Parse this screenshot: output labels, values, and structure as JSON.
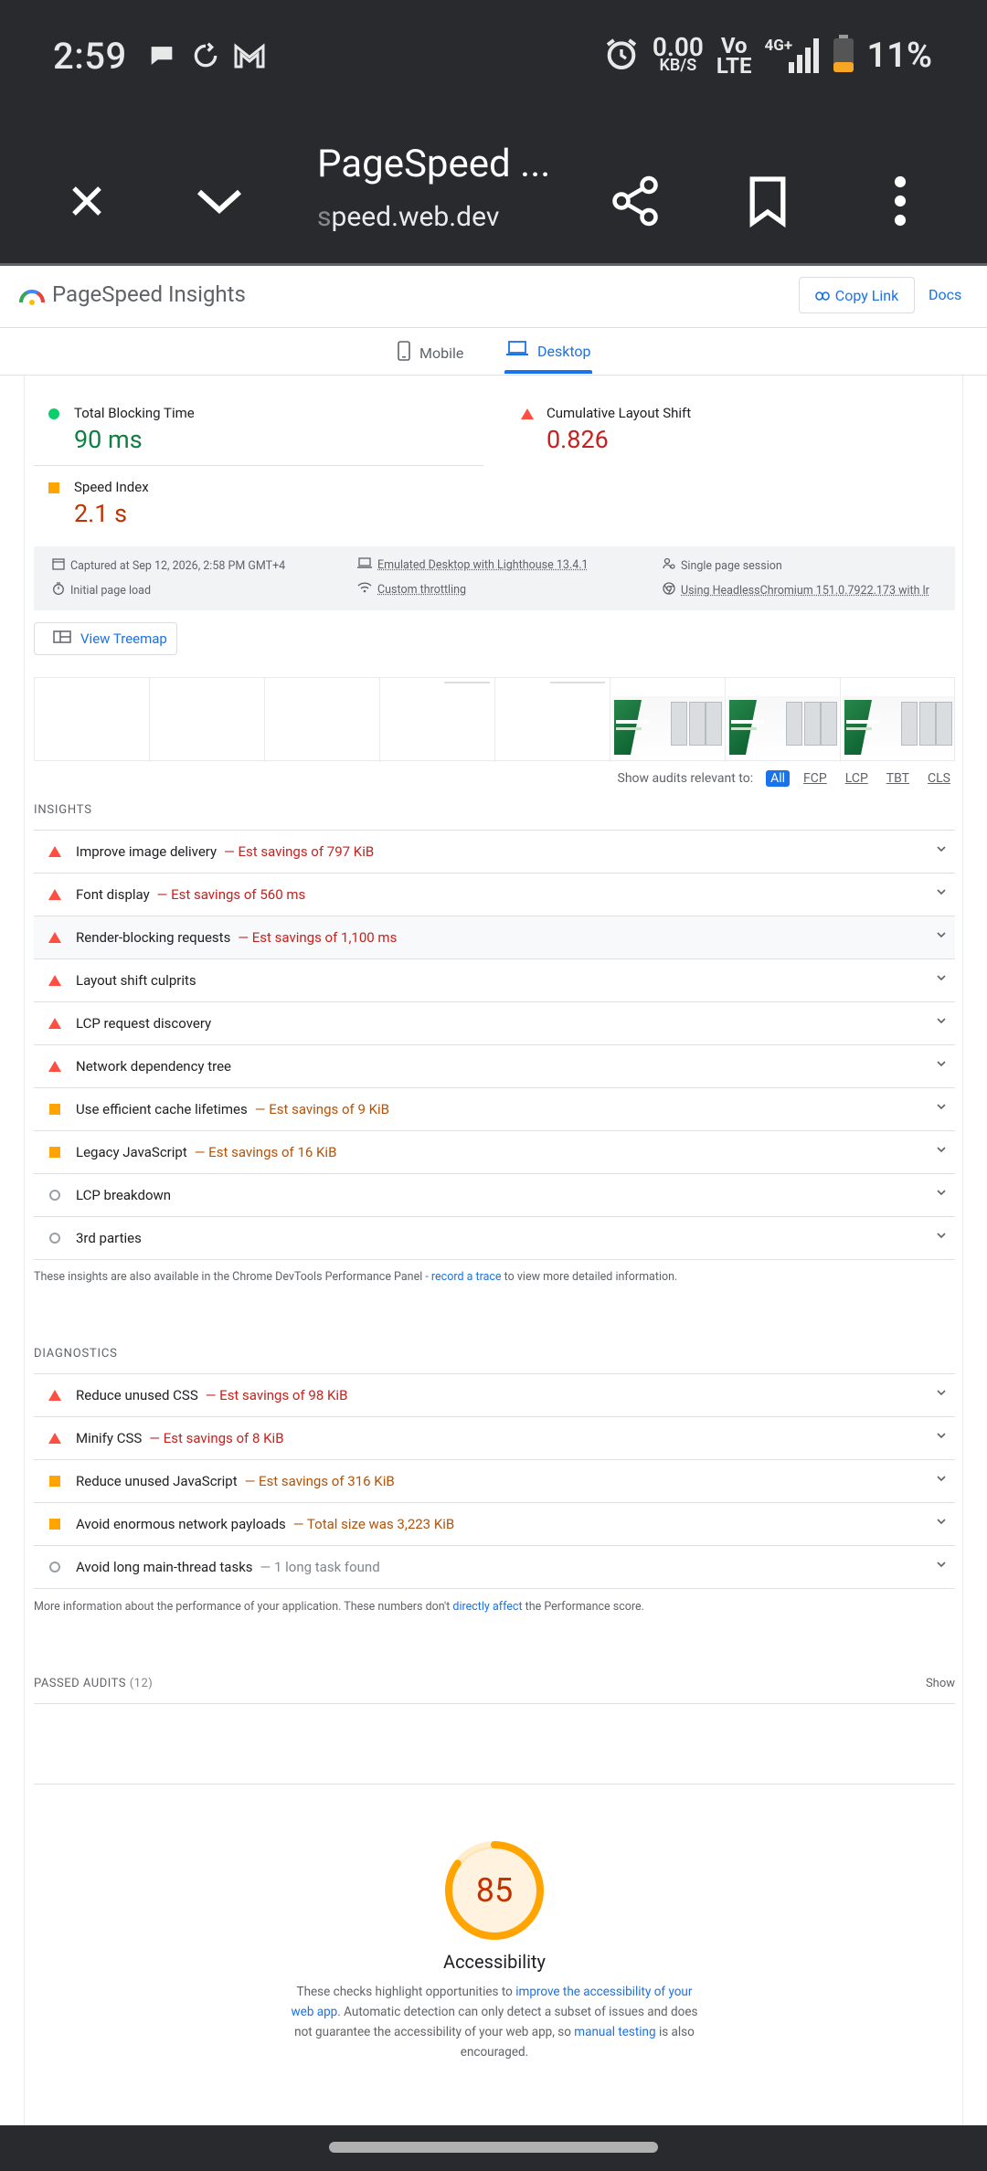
{
  "status_bar": {
    "time": "2:59",
    "net_speed": "0.00",
    "net_unit": "KB/S",
    "volte_top": "Vo",
    "volte_bottom": "LTE",
    "network": "4G+",
    "battery": "11%",
    "battery_color": "#f5a623"
  },
  "browser": {
    "title": "PageSpeed ...",
    "url_fade": "s",
    "url_rest": "peed.web.dev"
  },
  "header": {
    "title": "PageSpeed Insights",
    "copy_link": "Copy Link",
    "docs": "Docs"
  },
  "tabs": {
    "mobile": "Mobile",
    "desktop": "Desktop"
  },
  "metrics": {
    "tbt": {
      "label": "Total Blocking Time",
      "value": "90 ms",
      "status": "pass"
    },
    "cls": {
      "label": "Cumulative Layout Shift",
      "value": "0.826",
      "status": "fail"
    },
    "si": {
      "label": "Speed Index",
      "value": "2.1 s",
      "status": "average"
    }
  },
  "run_info": {
    "captured": "Captured at Sep 12, 2026, 2:58 PM GMT+4",
    "load": "Initial page load",
    "device": "Emulated Desktop with Lighthouse 13.4.1",
    "throttling": "Custom throttling",
    "session": "Single page session",
    "browser": "Using HeadlessChromium 151.0.7922.173 with lr"
  },
  "treemap_button": "View Treemap",
  "filter": {
    "label": "Show audits relevant to:",
    "options": [
      "All",
      "FCP",
      "LCP",
      "TBT",
      "CLS"
    ]
  },
  "insights": {
    "title": "INSIGHTS",
    "items": [
      {
        "label": "Improve image delivery",
        "savings": "— Est savings of 797 KiB",
        "severity": "fail"
      },
      {
        "label": "Font display",
        "savings": "— Est savings of 560 ms",
        "severity": "fail"
      },
      {
        "label": "Render-blocking requests",
        "savings": "— Est savings of 1,100 ms",
        "severity": "fail"
      },
      {
        "label": "Layout shift culprits",
        "savings": "",
        "severity": "fail"
      },
      {
        "label": "LCP request discovery",
        "savings": "",
        "severity": "fail"
      },
      {
        "label": "Network dependency tree",
        "savings": "",
        "severity": "fail"
      },
      {
        "label": "Use efficient cache lifetimes",
        "savings": "— Est savings of 9 KiB",
        "severity": "average"
      },
      {
        "label": "Legacy JavaScript",
        "savings": "— Est savings of 16 KiB",
        "severity": "average"
      },
      {
        "label": "LCP breakdown",
        "savings": "",
        "severity": "info"
      },
      {
        "label": "3rd parties",
        "savings": "",
        "severity": "info"
      }
    ],
    "note_pre": "These insights are also available in the Chrome DevTools Performance Panel - ",
    "note_link": "record a trace",
    "note_post": " to view more detailed information."
  },
  "diagnostics": {
    "title": "DIAGNOSTICS",
    "items": [
      {
        "label": "Reduce unused CSS",
        "savings": "— Est savings of 98 KiB",
        "severity": "fail"
      },
      {
        "label": "Minify CSS",
        "savings": "— Est savings of 8 KiB",
        "severity": "fail"
      },
      {
        "label": "Reduce unused JavaScript",
        "savings": "— Est savings of 316 KiB",
        "severity": "average"
      },
      {
        "label": "Avoid enormous network payloads",
        "savings": "— Total size was 3,223 KiB",
        "severity": "average"
      },
      {
        "label": "Avoid long main-thread tasks",
        "savings": "— 1 long task found",
        "severity": "info"
      }
    ],
    "note_pre": "More information about the performance of your application. These numbers don't ",
    "note_link": "directly affect",
    "note_post": " the Performance score."
  },
  "passed_audits": {
    "title": "PASSED AUDITS",
    "count": "(12)",
    "show": "Show"
  },
  "accessibility": {
    "score": 85,
    "score_text": "85",
    "title": "Accessibility",
    "desc_1": "These checks highlight opportunities to ",
    "desc_link1": "improve the accessibility of your web app",
    "desc_2": ". Automatic detection can only detect a subset of issues and does not guarantee the accessibility of your web app, so ",
    "desc_link2": "manual testing",
    "desc_3": " is also encouraged."
  },
  "colors": {
    "pass": "#0cce6b",
    "average": "#ffa400",
    "fail": "#ff4e42",
    "link": "#1a73e8"
  }
}
